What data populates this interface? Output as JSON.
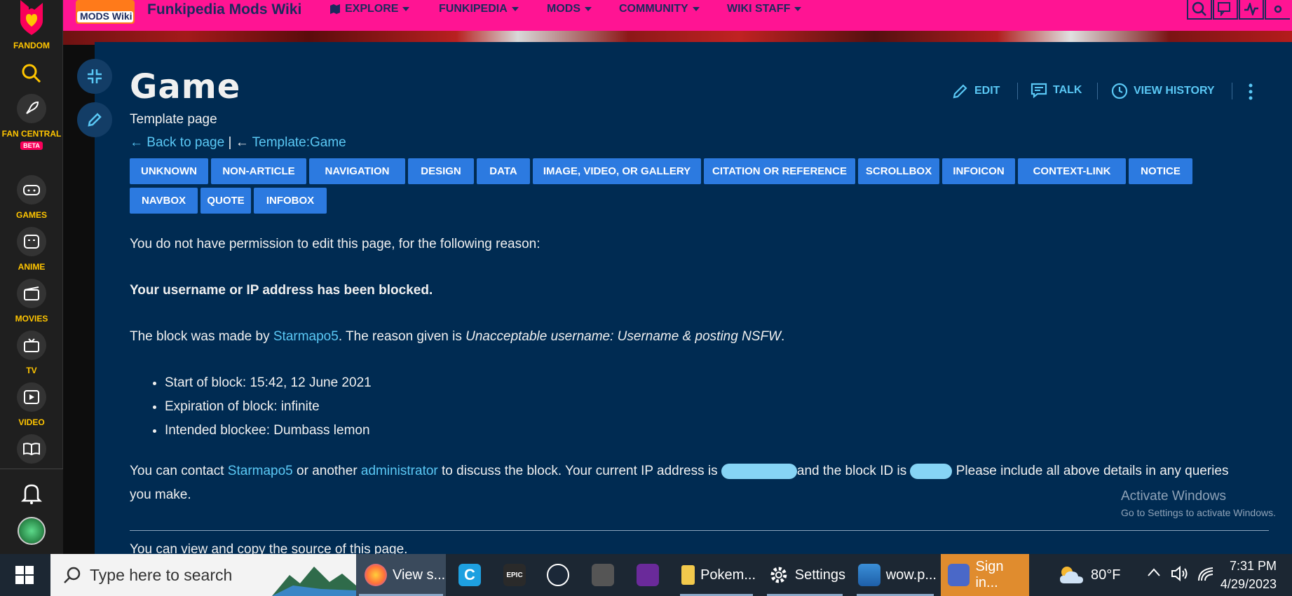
{
  "rail": {
    "brand": "FANDOM",
    "items": [
      "FAN CENTRAL",
      "GAMES",
      "ANIME",
      "MOVIES",
      "TV",
      "VIDEO"
    ],
    "beta": "BETA"
  },
  "topnav": {
    "wiki_name": "Funkipedia Mods Wiki",
    "logo_text": "MODS Wiki",
    "menus": [
      "EXPLORE",
      "FUNKIPEDIA",
      "MODS",
      "COMMUNITY",
      "WIKI STAFF"
    ]
  },
  "page": {
    "title": "Game",
    "subtitle": "Template page",
    "back_link": "Back to page",
    "back_sep": " | ← ",
    "template_link": "Template:Game",
    "actions": {
      "edit": "EDIT",
      "talk": "TALK",
      "history": "VIEW HISTORY"
    }
  },
  "tags": [
    "UNKNOWN",
    "NON-ARTICLE",
    "NAVIGATION",
    "DESIGN",
    "DATA",
    "IMAGE, VIDEO, OR GALLERY",
    "CITATION OR REFERENCE",
    "SCROLLBOX",
    "INFOICON",
    "CONTEXT-LINK",
    "NOTICE",
    "NAVBOX",
    "QUOTE",
    "INFOBOX"
  ],
  "body": {
    "permission": "You do not have permission to edit this page, for the following reason:",
    "blocked": "Your username or IP address has been blocked.",
    "block_by_pre": "The block was made by ",
    "blocker": "Starmapo5",
    "block_by_mid": ". The reason given is ",
    "reason": "Unacceptable username: Username & posting NSFW",
    "block_by_post": ".",
    "details": [
      "Start of block: 15:42, 12 June 2021",
      "Expiration of block: infinite",
      "Intended blockee: Dumbass lemon"
    ],
    "contact_pre": "You can contact ",
    "contact_or": " or another ",
    "admin": "administrator",
    "contact_mid": " to discuss the block. Your current IP address is ",
    "contact_mid2": "and the block ID is ",
    "contact_post": " Please include all above details in any queries",
    "contact_line2": "you make.",
    "source": "You can view and copy the source of this page."
  },
  "watermark": {
    "line1": "Activate Windows",
    "line2": "Go to Settings to activate Windows."
  },
  "taskbar": {
    "search_placeholder": "Type here to search",
    "apps": [
      "View s...",
      "Pokem...",
      "Settings",
      "wow.p...",
      "Sign in..."
    ],
    "weather": "80°F",
    "time": "7:31 PM",
    "date": "4/29/2023"
  },
  "colors": {
    "fandom_pink": "#ff1493",
    "content_bg": "#002b52",
    "link": "#5ac8f5",
    "tag_bg": "#2c7ae0",
    "rail_label": "#ffc500"
  }
}
